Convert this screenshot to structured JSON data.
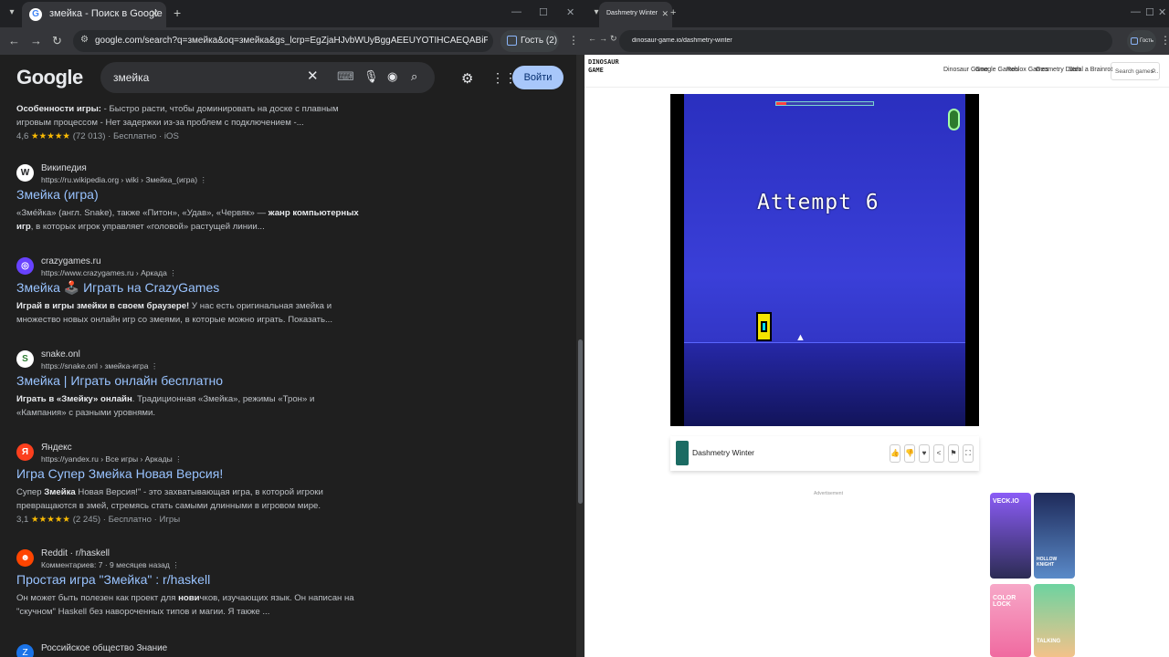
{
  "left_window": {
    "tab_title": "змейка - Поиск в Google",
    "url": "google.com/search?q=змейка&oq=змейка&gs_lcrp=EgZjaHJvbWUyBggAEEUYOTIHCAEQABiPAjIHC...",
    "guest_label": "Гость (2)",
    "google": {
      "logo": "Google",
      "query": "змейка",
      "signin": "Войти"
    },
    "top_snippet": {
      "text_bold": "Особенности игры:",
      "text": " - Быстро расти, чтобы доминировать на доске с плавным игровым процессом - Нет задержки из-за проблем с подключением -...",
      "rating": "4,6",
      "stars": "★★★★★",
      "meta": "(72 013) · Бесплатно · iOS"
    },
    "results": [
      {
        "site": "Википедия",
        "crumb": "https://ru.wikipedia.org › wiki › Змейка_(игра)",
        "title": "Змейка (игра)",
        "snippet_a": "«Зме́йка» (англ. Snake), также «Питон», «Удав», «Червяк» — ",
        "snippet_b": "жанр компьютерных игр",
        "snippet_c": ", в которых игрок управляет «головой» растущей линии...",
        "fav": "W",
        "fav_bg": "#ffffff",
        "fav_fg": "#202124"
      },
      {
        "site": "crazygames.ru",
        "crumb": "https://www.crazygames.ru › Аркада",
        "title": "Змейка 🕹️ Играть на CrazyGames",
        "snippet_a": "",
        "snippet_b": "Играй в игры змейки в своем браузере!",
        "snippet_c": " У нас есть оригинальная змейка и множество новых онлайн игр со змеями, в которые можно играть. Показать...",
        "fav": "◎",
        "fav_bg": "#6842ff",
        "fav_fg": "#ffffff"
      },
      {
        "site": "snake.onl",
        "crumb": "https://snake.onl › змейка-игра",
        "title": "Змейка | Играть онлайн бесплатно",
        "snippet_a": "",
        "snippet_b": "Играть в «Змейку» онлайн",
        "snippet_c": ". Традиционная «Змейка», режимы «Трон» и «Кампания» с разными уровнями.",
        "fav": "S",
        "fav_bg": "#ffffff",
        "fav_fg": "#2e7d32"
      },
      {
        "site": "Яндекс",
        "crumb": "https://yandex.ru › Все игры › Аркады",
        "title": "Игра Супер Змейка Новая Версия!",
        "snippet_a": "Супер ",
        "snippet_b": "Змейка",
        "snippet_c": " Новая Версия!\" - это захватывающая игра, в которой игроки превращаются в змей, стремясь стать самыми длинными в игровом мире.",
        "rating": "3,1",
        "stars": "★★★★★",
        "meta": "(2 245) · Бесплатно · Игры",
        "fav": "Я",
        "fav_bg": "#fc3f1d",
        "fav_fg": "#ffffff"
      },
      {
        "site": "Reddit · r/haskell",
        "crumb": "Комментариев: 7 · 9 месяцев назад",
        "title": "Простая игра \"Змейка\" : r/haskell",
        "snippet_a": "Он может быть полезен как проект для ",
        "snippet_b": "нови",
        "snippet_c": "чков, изучающих язык. Он написан на \"скучном\" Haskell без навороченных типов и магии. Я также ...",
        "fav": "☻",
        "fav_bg": "#ff4500",
        "fav_fg": "#ffffff"
      }
    ],
    "last_site": "Российское общество Знание"
  },
  "right_window": {
    "tab_title": "Dashmetry Winter",
    "url": "dinosaur-game.io/dashmetry-winter",
    "logo_line1": "DINOSAUR",
    "logo_line2": "GAME",
    "nav": [
      "Dinosaur Game",
      "Google Games",
      "Roblox Games",
      "Geometry Dash",
      "Steal a Brainrot"
    ],
    "search_placeholder": "Search games...",
    "game": {
      "attempt_text": "Attempt 6",
      "progress": 0.1,
      "name": "Dashmetry Winter"
    },
    "advertisement": "Advertisement",
    "cards": [
      "VECK.IO",
      "HOLLOW KNIGHT",
      "COLOR LOCK",
      "TALKING"
    ]
  }
}
